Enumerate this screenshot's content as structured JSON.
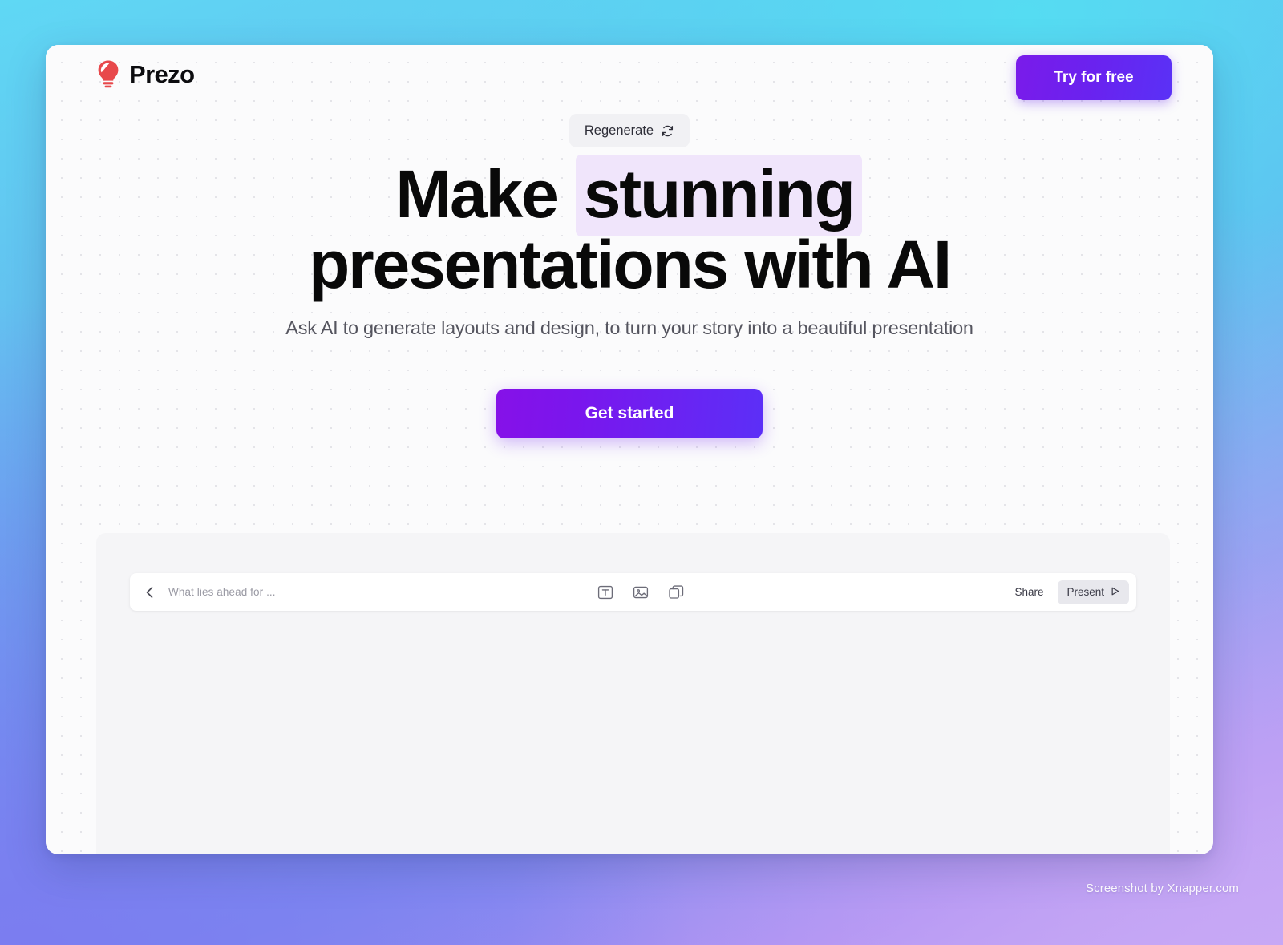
{
  "theme": {
    "accent_purple": "#6a22ef",
    "accent_gradient_start": "#8611e8",
    "accent_gradient_end": "#5c2ff7",
    "highlight_lavender": "#f0e5fb",
    "logo_red": "#e8484b",
    "card_background": "#fcfcfd",
    "panel_background": "#f5f5f7",
    "backdrop_cyan": "#5fd8f4",
    "backdrop_violet": "#c4a5f5"
  },
  "header": {
    "brand_name": "Prezo",
    "logo_icon": "lightbulb-icon",
    "cta_label": "Try for free"
  },
  "hero": {
    "regenerate": {
      "label": "Regenerate",
      "icon": "refresh-icon"
    },
    "headline": {
      "line1_before": "Make",
      "line1_highlight": "stunning",
      "line2": "presentations with AI"
    },
    "subheadline": "Ask AI to generate layouts and design, to turn your story into a beautiful presentation",
    "primary_cta": "Get started"
  },
  "editor": {
    "back_icon": "chevron-left-icon",
    "deck_title": "What lies ahead for ...",
    "tools": [
      {
        "name": "text-box-icon",
        "label": "Text"
      },
      {
        "name": "image-icon",
        "label": "Image"
      },
      {
        "name": "shape-icon",
        "label": "Shape"
      }
    ],
    "share_label": "Share",
    "present_label": "Present",
    "present_icon": "play-icon"
  },
  "watermark": "Screenshot by Xnapper.com"
}
